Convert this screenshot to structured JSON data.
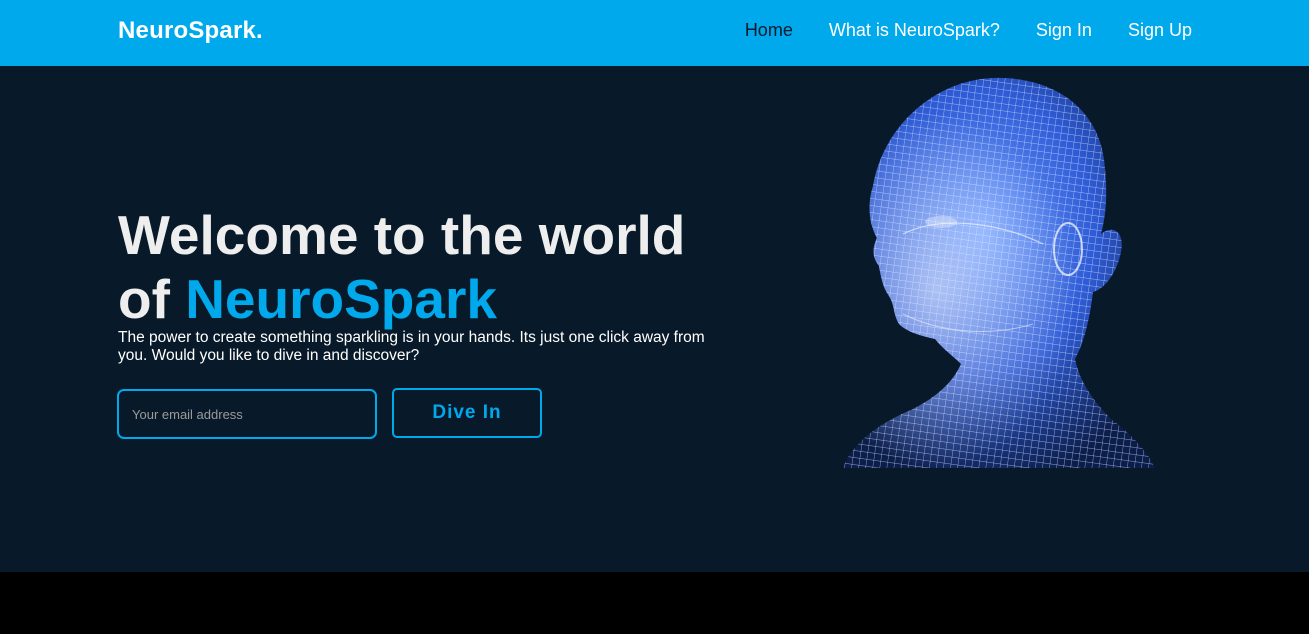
{
  "nav": {
    "brand": "NeuroSpark.",
    "links": [
      {
        "label": "Home"
      },
      {
        "label": "What is NeuroSpark?"
      },
      {
        "label": "Sign In"
      },
      {
        "label": "Sign Up"
      }
    ]
  },
  "hero": {
    "title_part1": "Welcome to the world of ",
    "title_accent": "NeuroSpark",
    "description": "The power to create something sparkling is in your hands. Its just one click away from you. Would you like to dive in and discover?",
    "email_placeholder": "Your email address",
    "email_value": "",
    "cta_label": "Dive In",
    "image_icon": "wireframe-head-illustration"
  },
  "colors": {
    "accent": "#00a8ec",
    "nav_bg": "#00a8ec",
    "hero_bg": "#081a29",
    "nav_active": "#0a1b2b",
    "footer_bg": "#000000"
  }
}
